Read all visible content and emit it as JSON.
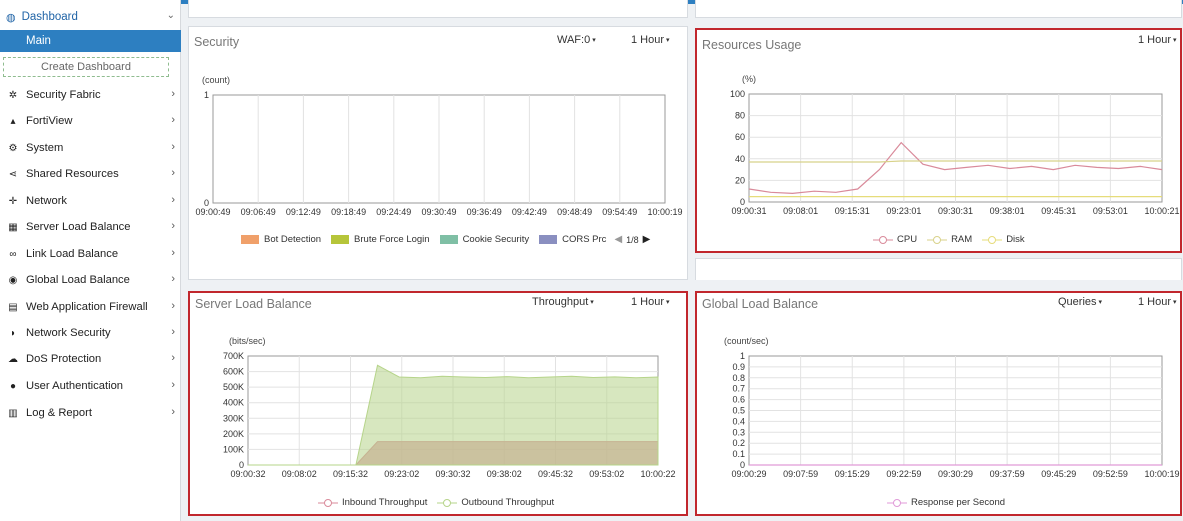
{
  "sidebar": {
    "dashboard": "Dashboard",
    "main": "Main",
    "create": "Create Dashboard",
    "items": [
      {
        "label": "Security Fabric",
        "icon": "security-fabric-icon",
        "glyph": "✲"
      },
      {
        "label": "FortiView",
        "icon": "fortiview-icon",
        "glyph": "▴"
      },
      {
        "label": "System",
        "icon": "gear-icon",
        "glyph": "⚙"
      },
      {
        "label": "Shared Resources",
        "icon": "share-icon",
        "glyph": "⋖"
      },
      {
        "label": "Network",
        "icon": "network-icon",
        "glyph": "✛"
      },
      {
        "label": "Server Load Balance",
        "icon": "server-load-balance-icon",
        "glyph": "▦"
      },
      {
        "label": "Link Load Balance",
        "icon": "link-icon",
        "glyph": "∞"
      },
      {
        "label": "Global Load Balance",
        "icon": "globe-icon",
        "glyph": "◉"
      },
      {
        "label": "Web Application Firewall",
        "icon": "firewall-icon",
        "glyph": "▤"
      },
      {
        "label": "Network Security",
        "icon": "shield-icon",
        "glyph": "◗"
      },
      {
        "label": "DoS Protection",
        "icon": "cloud-icon",
        "glyph": "☁"
      },
      {
        "label": "User Authentication",
        "icon": "user-icon",
        "glyph": "●"
      },
      {
        "label": "Log & Report",
        "icon": "chart-icon",
        "glyph": "▥"
      }
    ]
  },
  "panels": {
    "security": {
      "title": "Security",
      "dropdown1": "WAF:0",
      "dropdown2": "1 Hour",
      "unit": "(count)",
      "pager": "1/8"
    },
    "resources": {
      "title": "Resources Usage",
      "dropdown1": "1 Hour",
      "unit": "(%)"
    },
    "slb": {
      "title": "Server Load Balance",
      "dropdown1": "Throughput",
      "dropdown2": "1 Hour",
      "unit": "(bits/sec)"
    },
    "glb": {
      "title": "Global Load Balance",
      "dropdown1": "Queries",
      "dropdown2": "1 Hour",
      "unit": "(count/sec)"
    }
  },
  "chart_data": [
    {
      "id": "security",
      "type": "line",
      "ylabel": "(count)",
      "yticks": [
        "0",
        "1"
      ],
      "ylim": [
        0,
        1
      ],
      "categories": [
        "09:00:49",
        "09:06:49",
        "09:12:49",
        "09:18:49",
        "09:24:49",
        "09:30:49",
        "09:36:49",
        "09:42:49",
        "09:48:49",
        "09:54:49",
        "10:00:19"
      ],
      "series": [
        {
          "name": "Bot Detection",
          "color": "#f0a06a",
          "values": []
        },
        {
          "name": "Brute Force Login",
          "color": "#b6c53a",
          "values": []
        },
        {
          "name": "Cookie Security",
          "color": "#7fbfa5",
          "values": []
        },
        {
          "name": "CORS Prc",
          "color": "#8a8fc0",
          "values": []
        }
      ],
      "grid": true
    },
    {
      "id": "resources",
      "type": "line",
      "ylabel": "(%)",
      "yticks": [
        "0",
        "20",
        "40",
        "60",
        "80",
        "100"
      ],
      "ylim": [
        0,
        100
      ],
      "categories": [
        "09:00:31",
        "09:08:01",
        "09:15:31",
        "09:23:01",
        "09:30:31",
        "09:38:01",
        "09:45:31",
        "09:53:01",
        "10:00:21"
      ],
      "series": [
        {
          "name": "CPU",
          "color": "#d98a9a",
          "values": [
            12,
            9,
            8,
            10,
            9,
            12,
            30,
            55,
            35,
            30,
            32,
            34,
            31,
            33,
            30,
            34,
            32,
            31,
            33,
            30
          ]
        },
        {
          "name": "RAM",
          "color": "#d8d28a",
          "values": [
            37,
            37,
            37,
            37,
            37,
            37,
            37,
            38,
            38,
            38,
            38,
            38,
            38,
            38,
            38,
            38,
            38,
            38,
            38,
            38
          ]
        },
        {
          "name": "Disk",
          "color": "#e6dc7a",
          "values": [
            5,
            5,
            5,
            5,
            5,
            5,
            5,
            5,
            5,
            5,
            5,
            5,
            5,
            5,
            5,
            5,
            5,
            5,
            5,
            5
          ]
        }
      ],
      "grid": true
    },
    {
      "id": "slb",
      "type": "area",
      "ylabel": "(bits/sec)",
      "yticks": [
        "0",
        "100K",
        "200K",
        "300K",
        "400K",
        "500K",
        "600K",
        "700K"
      ],
      "ylim": [
        0,
        700000
      ],
      "categories": [
        "09:00:32",
        "09:08:02",
        "09:15:32",
        "09:23:02",
        "09:30:32",
        "09:38:02",
        "09:45:32",
        "09:53:02",
        "10:00:22"
      ],
      "series": [
        {
          "name": "Inbound Throughput",
          "color": "#d98a9a",
          "values": [
            0,
            0,
            0,
            0,
            0,
            0,
            150000,
            150000,
            150000,
            150000,
            150000,
            150000,
            150000,
            150000,
            150000,
            150000,
            150000,
            150000,
            150000,
            150000
          ]
        },
        {
          "name": "Outbound Throughput",
          "color": "#b6d48a",
          "values": [
            0,
            0,
            0,
            0,
            0,
            0,
            640000,
            565000,
            560000,
            570000,
            565000,
            562000,
            568000,
            560000,
            565000,
            570000,
            562000,
            566000,
            560000,
            565000
          ]
        }
      ],
      "grid": true
    },
    {
      "id": "glb",
      "type": "line",
      "ylabel": "(count/sec)",
      "yticks": [
        "0",
        "0.1",
        "0.2",
        "0.3",
        "0.4",
        "0.5",
        "0.6",
        "0.7",
        "0.8",
        "0.9",
        "1"
      ],
      "ylim": [
        0,
        1
      ],
      "categories": [
        "09:00:29",
        "09:07:59",
        "09:15:29",
        "09:22:59",
        "09:30:29",
        "09:37:59",
        "09:45:29",
        "09:52:59",
        "10:00:19"
      ],
      "series": [
        {
          "name": "Response per Second",
          "color": "#e09ad8",
          "values": [
            0,
            0,
            0,
            0,
            0,
            0,
            0,
            0,
            0,
            0
          ]
        }
      ],
      "grid": true
    }
  ]
}
